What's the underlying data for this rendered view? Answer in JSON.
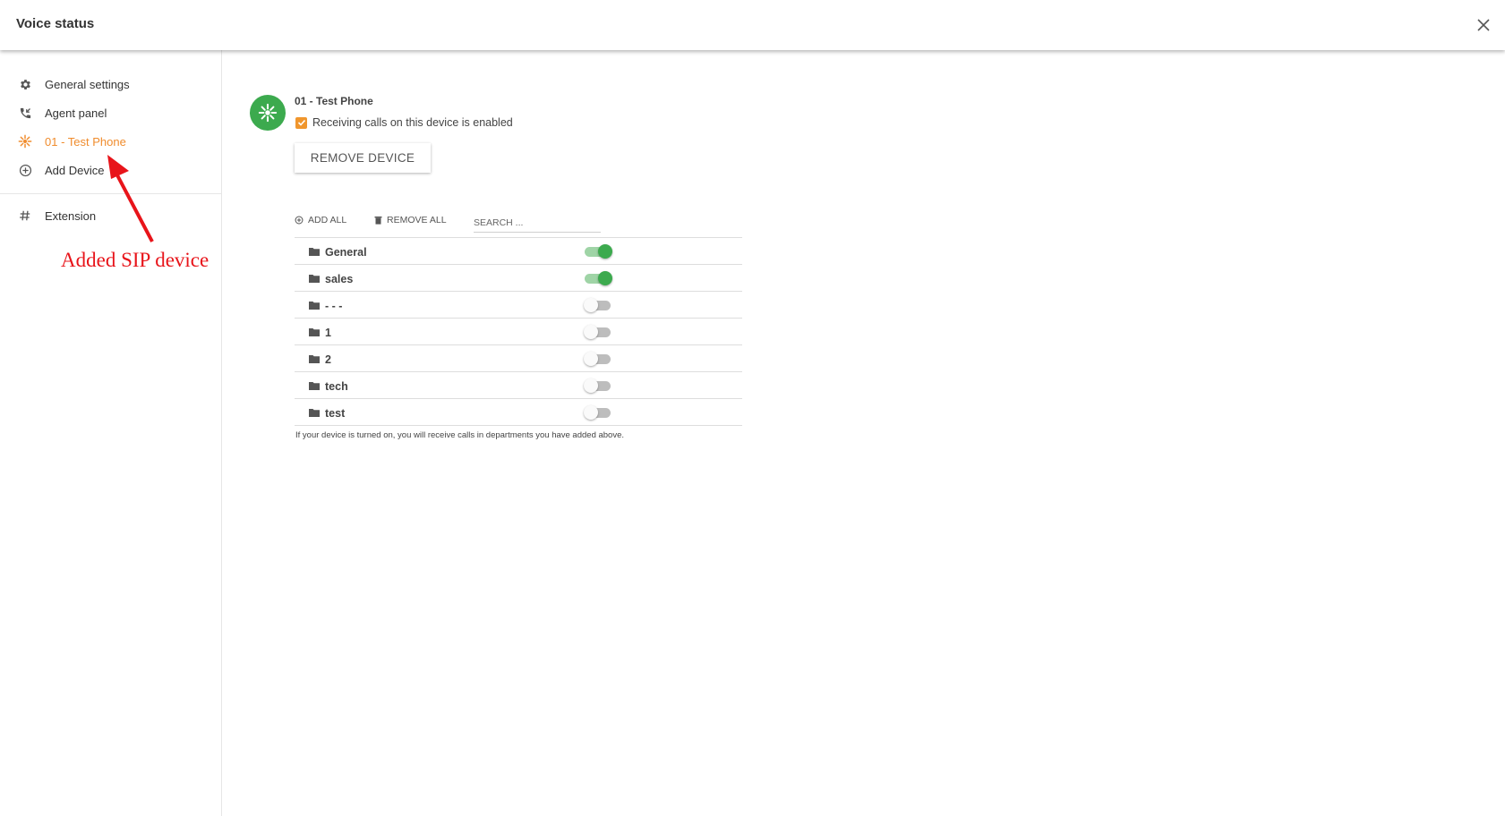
{
  "header": {
    "title": "Voice status"
  },
  "sidebar": {
    "items": [
      {
        "label": "General settings",
        "icon": "gear-icon"
      },
      {
        "label": "Agent panel",
        "icon": "phone-incoming-icon"
      },
      {
        "label": "01 - Test Phone",
        "icon": "sip-device-icon",
        "active": true
      },
      {
        "label": "Add Device",
        "icon": "plus-circle-icon"
      }
    ],
    "extension": {
      "label": "Extension",
      "icon": "hash-icon"
    }
  },
  "annotation": {
    "text": "Added SIP device",
    "color": "#e8141a"
  },
  "device": {
    "name": "01 - Test Phone",
    "enabled_label": "Receiving calls on this device is enabled",
    "enabled": true,
    "remove_label": "REMOVE DEVICE"
  },
  "toolbar": {
    "add_all": "ADD ALL",
    "remove_all": "REMOVE ALL",
    "search_placeholder": "SEARCH ..."
  },
  "departments": [
    {
      "name": "General",
      "on": true
    },
    {
      "name": "sales",
      "on": true
    },
    {
      "name": "- - -",
      "on": false
    },
    {
      "name": "1",
      "on": false
    },
    {
      "name": "2",
      "on": false
    },
    {
      "name": "tech",
      "on": false
    },
    {
      "name": "test",
      "on": false
    }
  ],
  "footnote": "If your device is turned on, you will receive calls in departments you have added above.",
  "colors": {
    "accent": "#f08c2d",
    "green": "#3caa4e",
    "toggle_off": "#bdbdbd"
  }
}
